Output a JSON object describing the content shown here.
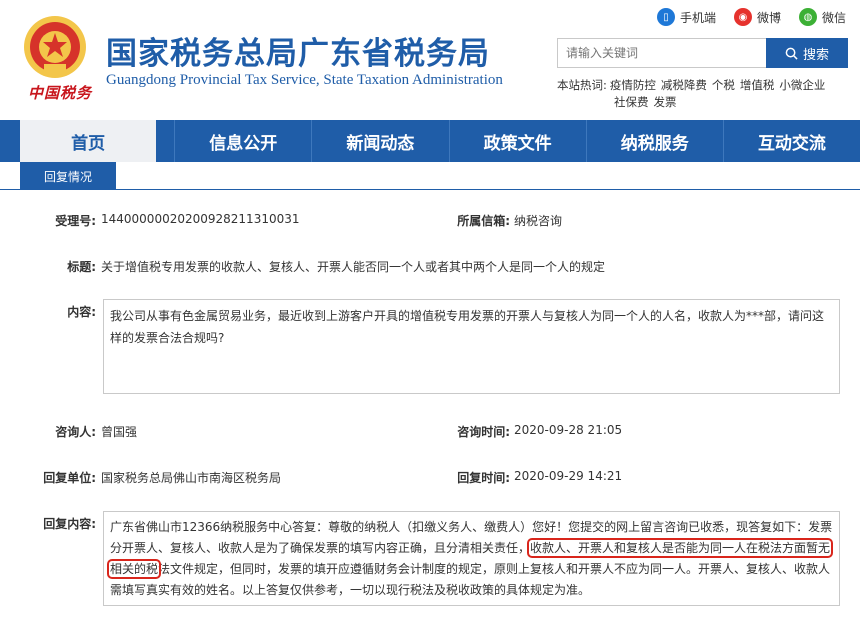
{
  "header": {
    "emblem_text": "中国税务",
    "title": "国家税务总局广东省税务局",
    "subtitle": "Guangdong Provincial Tax Service, State Taxation Administration",
    "links": [
      {
        "label": "手机端",
        "icon": "mobile-icon",
        "color": "#1e78d7"
      },
      {
        "label": "微博",
        "icon": "weibo-icon",
        "color": "#e6322d"
      },
      {
        "label": "微信",
        "icon": "wechat-icon",
        "color": "#3cb035"
      }
    ],
    "search_placeholder": "请输入关键词",
    "search_label": "搜索",
    "hot_label": "本站热词:",
    "hot_words": [
      "疫情防控",
      "减税降费",
      "个税",
      "增值税",
      "小微企业",
      "社保费",
      "发票"
    ]
  },
  "nav": [
    "首页",
    "信息公开",
    "新闻动态",
    "政策文件",
    "纳税服务",
    "互动交流"
  ],
  "tab_label": "回复情况",
  "detail": {
    "id_label": "受理号:",
    "id_value": "1440000002020092821131003​1",
    "mailbox_label": "所属信箱:",
    "mailbox_value": "纳税咨询",
    "subject_label": "标题:",
    "subject_value": "关于增值税专用发票的收款人、复核人、开票人能否同一个人或者其中两个人是同一个人的规定",
    "content_label": "内容:",
    "content_value": "我公司从事有色金属贸易业务，最近收到上游客户开具的增值税专用发票的开票人与复核人为同一个人的人名，收款人为***部，请问这样的发票合法合规吗?",
    "asker_label": "咨询人:",
    "asker_value": "曾国强",
    "ask_time_label": "咨询时间:",
    "ask_time_value": "2020-09-28 21:05",
    "reply_unit_label": "回复单位:",
    "reply_unit_value": "国家税务总局佛山市南海区税务局",
    "reply_time_label": "回复时间:",
    "reply_time_value": "2020-09-29 14:21",
    "reply_label": "回复内容:",
    "reply_before": "广东省佛山市12366纳税服务中心答复：尊敬的纳税人（扣缴义务人、缴费人）您好！您提交的网上留言咨询已收悉，现答复如下：发票分开票人、复核人、收款人是为了确保发票的填写内容正确，且分清相关责任，",
    "reply_highlight": "收款人、开票人和复核人是否能为同一人在税法方面暂无相关的税",
    "reply_after": "法文件规定，但同时，发票的填开应遵循财务会计制度的规定，原则上复核人和开票人不应为同一人。开票人、复核人、收款人需填写真实有效的姓名。以上答复仅供参考，一切以现行税法及税收政策的具体规定为准。"
  }
}
